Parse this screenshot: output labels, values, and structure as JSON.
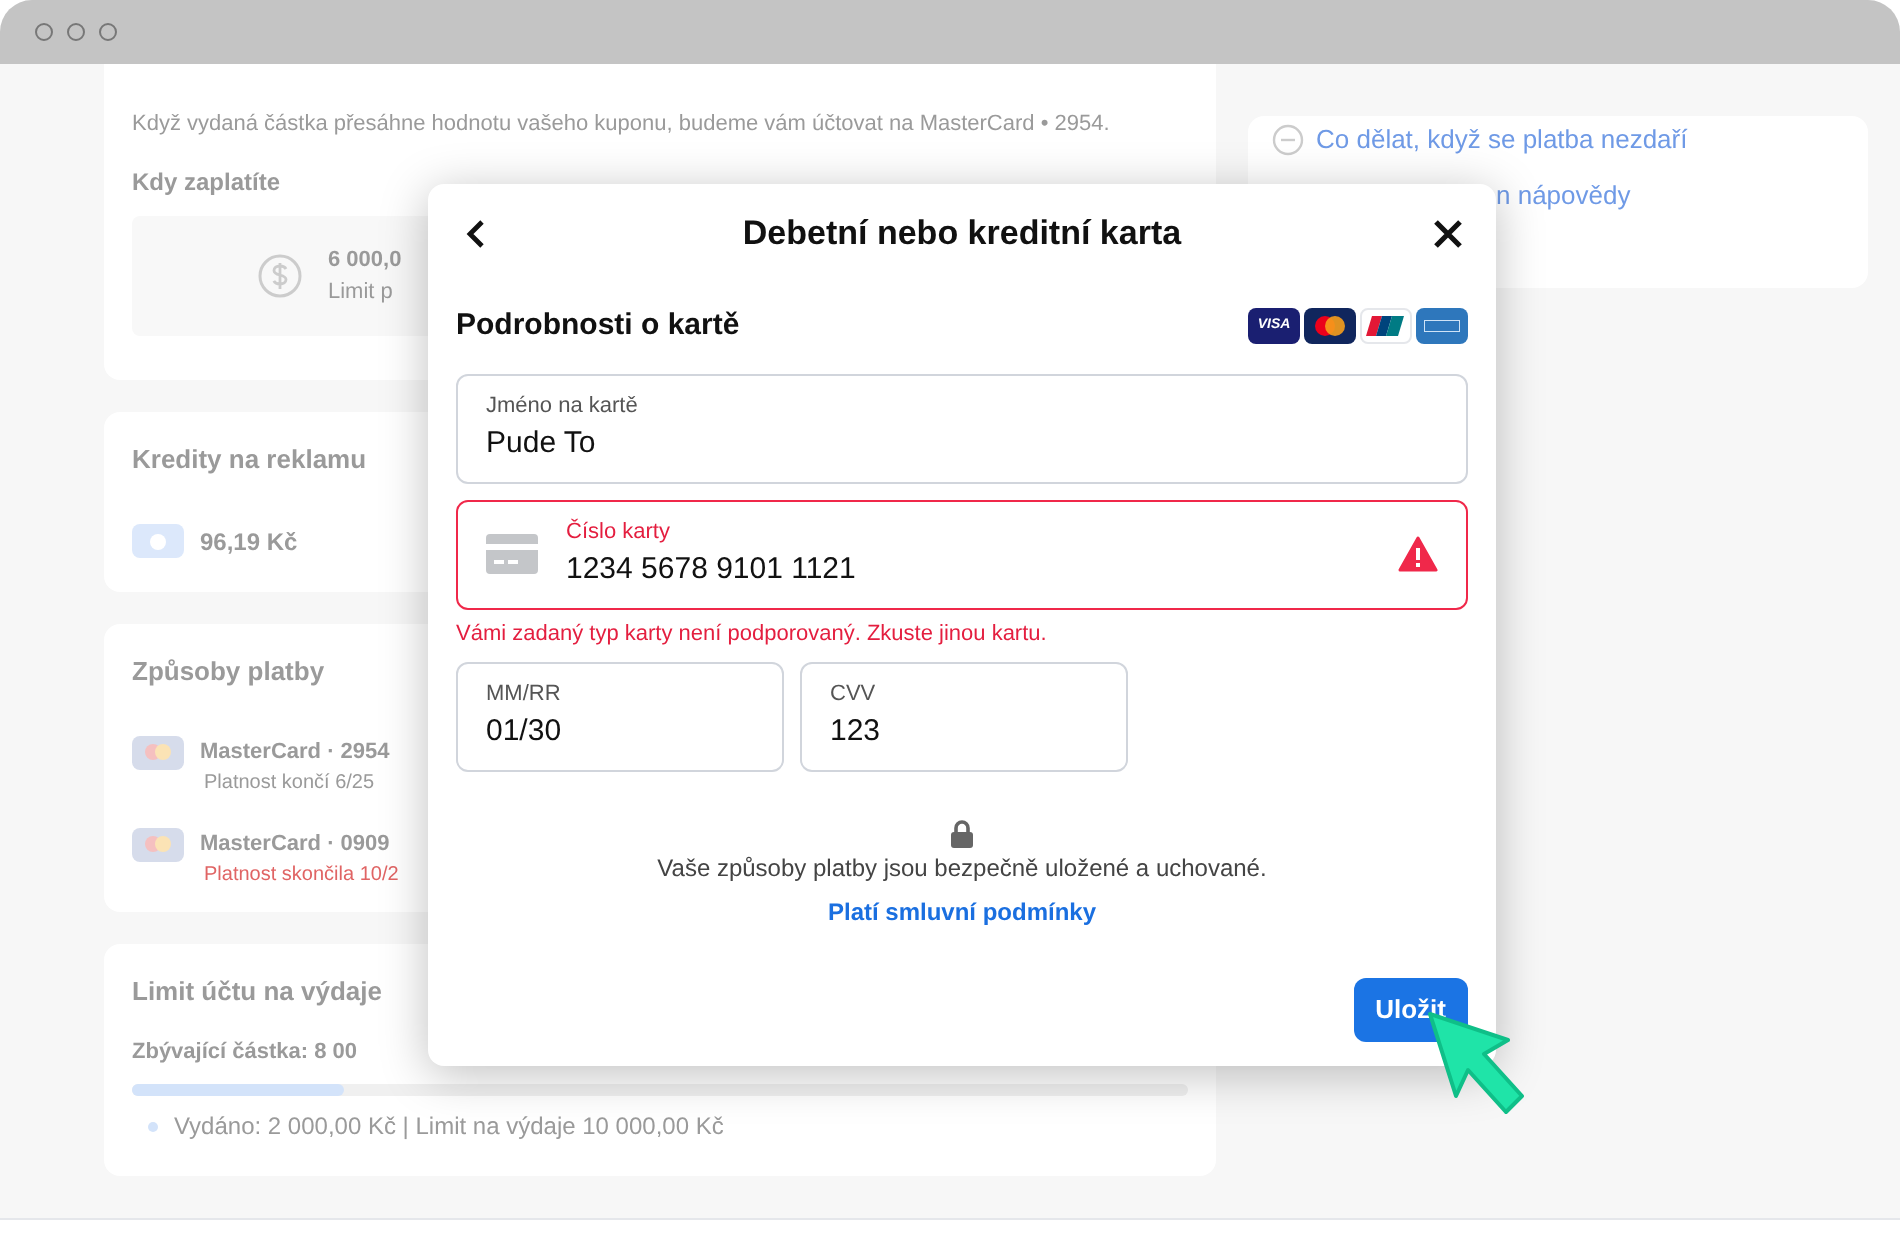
{
  "background": {
    "coupon_note": "Když vydaná částka přesáhne hodnotu vašeho kuponu, budeme vám účtovat na MasterCard • 2954.",
    "when_pay": {
      "heading": "Kdy zaplatíte",
      "amount": "6 000,0",
      "limit": "Limit p"
    },
    "ad_credits": {
      "heading": "Kredity na reklamu",
      "amount": "96,19 Kč"
    },
    "payment_methods": {
      "heading": "Způsoby platby",
      "items": [
        {
          "name": "MasterCard · 2954",
          "validity": "Platnost končí 6/25",
          "expired": false
        },
        {
          "name": "MasterCard · 0909",
          "validity": "Platnost skončila 10/2",
          "expired": true
        }
      ]
    },
    "spending_limit": {
      "heading": "Limit účtu na výdaje",
      "remaining": "Zbývající částka: 8 00",
      "level": 0.2,
      "detail": "Vydáno: 2 000,00 Kč | Limit na výdaje 10 000,00 Kč"
    },
    "help_links": [
      "Co dělat, když se platba nezdaří",
      "n nápovědy"
    ]
  },
  "dialog": {
    "title": "Debetní nebo kreditní karta",
    "section": "Podrobnosti o kartě",
    "card_brands": [
      {
        "kind": "visa",
        "label": "VISA"
      },
      {
        "kind": "mastercard"
      },
      {
        "kind": "unionpay"
      },
      {
        "kind": "amex"
      }
    ],
    "fields": [
      {
        "label": "Jméno na kartě",
        "value": "Pude To",
        "error": false
      },
      {
        "label": "Číslo karty",
        "value": "1234 5678 9101 1121",
        "error": true,
        "error_message": "Vámi zadaný typ karty není podporovaný. Zkuste jinou kartu."
      },
      {
        "label": "MM/RR",
        "value": "01/30",
        "error": false
      },
      {
        "label": "CVV",
        "value": "123",
        "error": false
      }
    ],
    "security_note": "Vaše způsoby platby jsou bezpečně uložené a uchované.",
    "terms_link": "Platí smluvní podmínky",
    "save_button": "Uložit"
  }
}
